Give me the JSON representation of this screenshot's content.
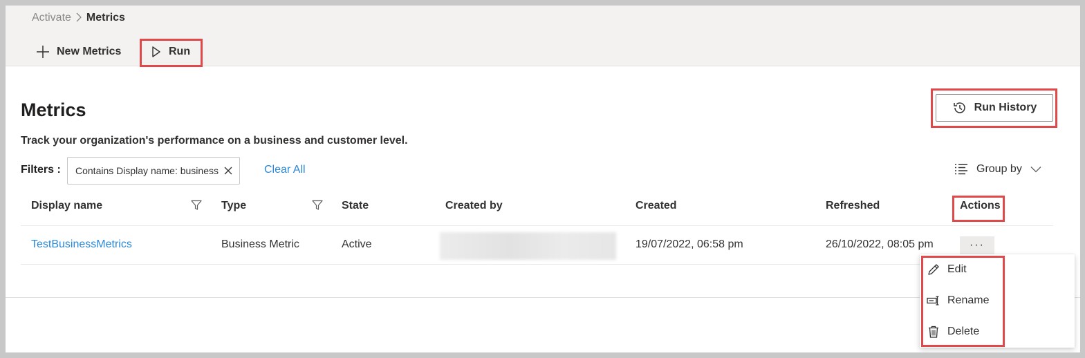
{
  "breadcrumb": {
    "parent": "Activate",
    "separator": ">",
    "current": "Metrics"
  },
  "commandbar": {
    "new_label": "New Metrics",
    "run_label": "Run"
  },
  "page": {
    "title": "Metrics",
    "subtitle": "Track your organization's performance on a business and customer level.",
    "run_history_label": "Run History"
  },
  "filters": {
    "label": "Filters :",
    "chips": [
      "Contains Display name: business"
    ],
    "clear_all": "Clear All"
  },
  "group_by": {
    "label": "Group by"
  },
  "table": {
    "columns": [
      "Display name",
      "Type",
      "State",
      "Created by",
      "Created",
      "Refreshed",
      "Actions"
    ],
    "rows": [
      {
        "display_name": "TestBusinessMetrics",
        "type": "Business Metric",
        "state": "Active",
        "created_by": "",
        "created": "19/07/2022, 06:58 pm",
        "refreshed": "26/10/2022, 08:05 pm",
        "actions": "···"
      }
    ]
  },
  "context_menu": {
    "items": [
      "Edit",
      "Rename",
      "Delete"
    ]
  },
  "colors": {
    "link": "#2b88d8",
    "highlight": "#e0484a",
    "topbar": "#f3f2f1"
  }
}
